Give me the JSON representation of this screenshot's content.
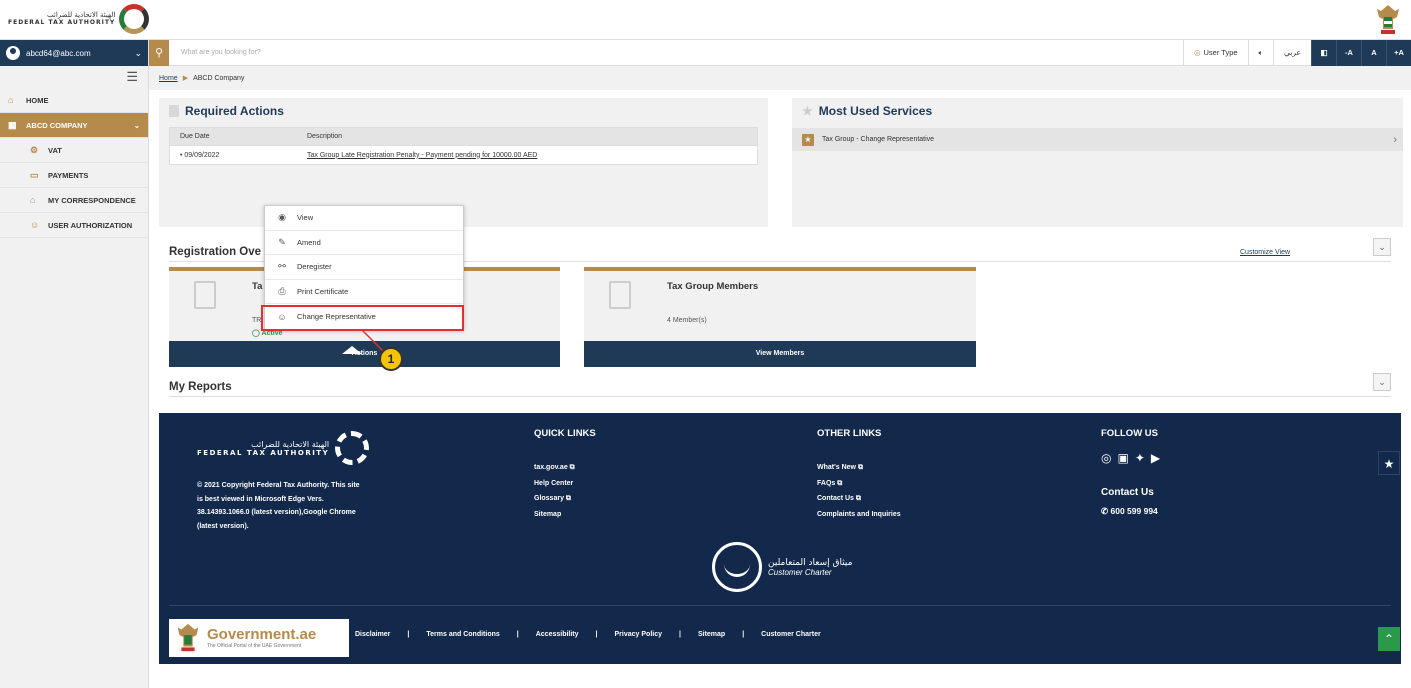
{
  "header": {
    "logo_ar": "الهيئة الاتحادية للضرائب",
    "logo_en": "FEDERAL TAX AUTHORITY"
  },
  "sidebar": {
    "user_email": "abcd64@abc.com",
    "items": [
      {
        "label": "HOME",
        "icon": "home-icon"
      },
      {
        "label": "ABCD COMPANY",
        "icon": "grid-icon"
      },
      {
        "label": "VAT",
        "icon": "vat-icon"
      },
      {
        "label": "PAYMENTS",
        "icon": "payments-icon"
      },
      {
        "label": "MY CORRESPONDENCE",
        "icon": "correspondence-icon"
      },
      {
        "label": "USER AUTHORIZATION",
        "icon": "user-auth-icon"
      }
    ]
  },
  "search": {
    "placeholder": "What are you looking for?"
  },
  "tools": {
    "user_type": "User Type",
    "lang": "عربي",
    "font_minus": "-A",
    "font_normal": "A",
    "font_plus": "+A"
  },
  "breadcrumb": {
    "home": "Home",
    "current": "ABCD Company"
  },
  "required_actions": {
    "title": "Required Actions",
    "col_due": "Due Date",
    "col_desc": "Description",
    "rows": [
      {
        "due": "• 09/09/2022",
        "desc": "Tax Group Late Registration Penalty - Payment pending for 10000.00 AED"
      }
    ]
  },
  "most_used": {
    "title": "Most Used Services",
    "items": [
      "Tax Group - Change Representative"
    ]
  },
  "registration": {
    "title": "Registration Ove",
    "customize": "Customize View",
    "card1": {
      "title": "Ta",
      "trn": "TR",
      "status": "Active",
      "button": "Actions"
    },
    "card2": {
      "title": "Tax Group Members",
      "sub": "4 Member(s)",
      "button": "View Members"
    }
  },
  "actions_menu": {
    "items": [
      "View",
      "Amend",
      "Deregister",
      "Print Certificate",
      "Change Representative"
    ]
  },
  "callout": "1",
  "reports": {
    "title": "My Reports"
  },
  "footer": {
    "logo_ar": "الهيئة الاتحادية للضرائب",
    "logo_en": "FEDERAL TAX AUTHORITY",
    "copyright": "© 2021 Copyright Federal Tax Authority. This site is best viewed in Microsoft Edge Vers. 38.14393.1066.0 (latest version),Google Chrome (latest version).",
    "quick_links_title": "QUICK LINKS",
    "quick_links": [
      "tax.gov.ae",
      "Help Center",
      "Glossary",
      "Sitemap"
    ],
    "other_links_title": "OTHER LINKS",
    "other_links": [
      "What's New",
      "FAQs",
      "Contact Us",
      "Complaints and Inquiries"
    ],
    "follow_title": "FOLLOW US",
    "contact_title": "Contact Us",
    "phone": "600 599 994",
    "charter_ar": "ميثاق إسعاد المتعاملين",
    "charter_en": "Customer Charter",
    "gov_title": "Government.ae",
    "gov_sub": "The Official Portal of the UAE Government",
    "bottom_links": [
      "Disclaimer",
      "|",
      "Terms and Conditions",
      "|",
      "Accessibility",
      "|",
      "Privacy Policy",
      "|",
      "Sitemap",
      "|",
      "Customer Charter"
    ]
  }
}
